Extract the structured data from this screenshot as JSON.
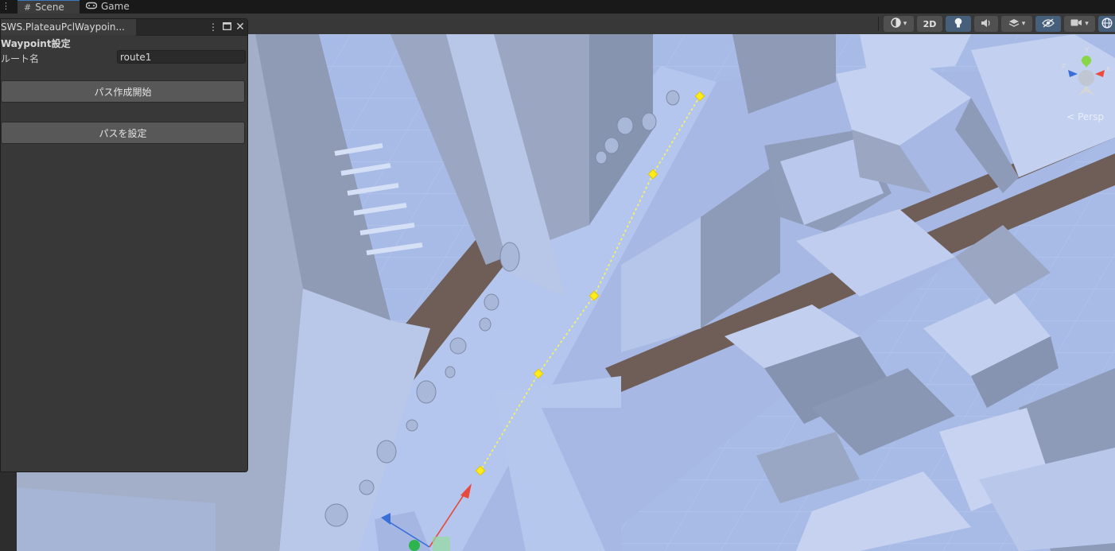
{
  "tabs": [
    {
      "label": "Scene",
      "icon": "grid-icon",
      "active": true
    },
    {
      "label": "Game",
      "icon": "gamepad-icon",
      "active": false
    }
  ],
  "toolbar": {
    "shading_icon": "shading-sphere-icon",
    "mode_2d_label": "2D",
    "lighting_icon": "lightbulb-icon",
    "audio_icon": "audio-icon",
    "effects_icon": "layers-icon",
    "visibility_icon": "eye-off-icon",
    "camera_icon": "camera-icon",
    "gizmos_icon": "gizmo-globe-icon",
    "accent_color": "#46607c"
  },
  "editor_window": {
    "title": "SWS.PlateauPclWaypoin...",
    "heading": "Waypoint設定",
    "route_label": "ルート名",
    "route_value": "route1",
    "start_button": "パス作成開始",
    "set_button": "パスを設定"
  },
  "viewport": {
    "gizmo_axis_y": "y",
    "gizmo_axis_x": "x",
    "gizmo_axis_z": "z",
    "projection_label": "< Persp",
    "waypoint_color": "#ffec1a",
    "path_color": "#f3f06a"
  }
}
